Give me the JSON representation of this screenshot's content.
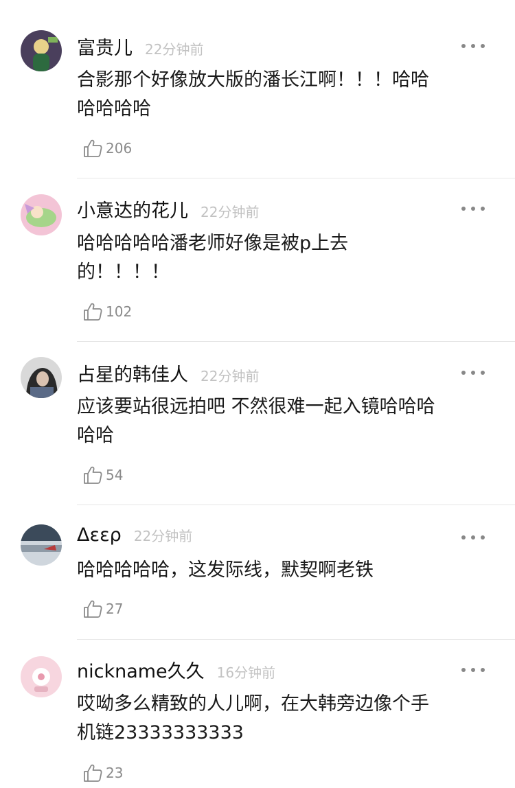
{
  "comments": [
    {
      "username": "富贵儿",
      "time": "22分钟前",
      "lines": [
        "合影那个好像放大版的潘长江啊！！！哈哈",
        "哈哈哈哈"
      ],
      "likes": "206",
      "avatar_colors": [
        "#2d6a3f",
        "#e8d28a"
      ]
    },
    {
      "username": "小意达的花儿",
      "time": "22分钟前",
      "lines": [
        "哈哈哈哈哈潘老师好像是被p上去",
        "的！！！！"
      ],
      "likes": "102",
      "avatar_colors": [
        "#f3c4d6",
        "#a6d58a"
      ]
    },
    {
      "username": "占星的韩佳人",
      "time": "22分钟前",
      "lines": [
        "应该要站很远拍吧 不然很难一起入镜哈哈哈",
        "哈哈"
      ],
      "likes": "54",
      "avatar_colors": [
        "#2a2a2a",
        "#d9c2b0"
      ]
    },
    {
      "username": "Δεερ",
      "time": "22分钟前",
      "lines": [
        "哈哈哈哈哈，这发际线，默契啊老铁"
      ],
      "likes": "27",
      "avatar_colors": [
        "#3b4a5a",
        "#cfd6dd"
      ]
    },
    {
      "username": "nickname久久",
      "time": "16分钟前",
      "lines": [
        "哎呦多么精致的人儿啊，在大韩旁边像个手",
        "机链23333333333"
      ],
      "likes": "23",
      "avatar_colors": [
        "#f7d6df",
        "#ffffff"
      ]
    }
  ],
  "icons": {
    "more": "more-dots-icon",
    "like": "thumb-up-icon"
  },
  "colors": {
    "username": "#111111",
    "time": "#c2c2c2",
    "content": "#1a1a1a",
    "like_count": "#8a8a8a",
    "divider": "#e6e6e6"
  }
}
